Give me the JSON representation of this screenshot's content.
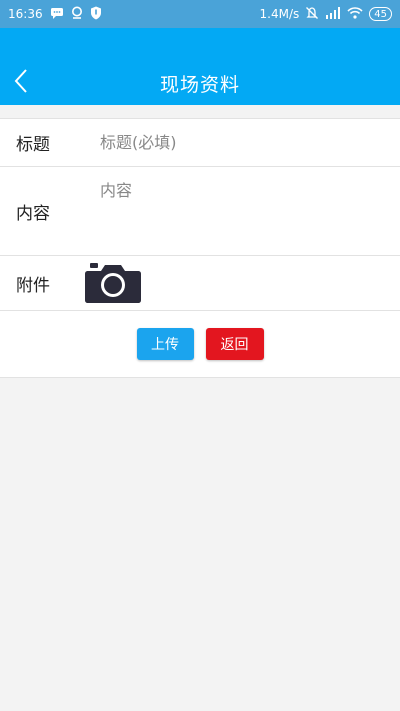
{
  "status_bar": {
    "time": "16:36",
    "network_speed": "1.4M/s",
    "battery": "45",
    "icons": [
      "message-icon",
      "location-icon",
      "shield-icon",
      "mute-icon",
      "signal-icon",
      "wifi-icon"
    ]
  },
  "header": {
    "title": "现场资料",
    "back_icon": "chevron-left-icon",
    "bg_color": "#03a9f4"
  },
  "form": {
    "title_label": "标题",
    "title_placeholder": "标题(必填)",
    "content_label": "内容",
    "content_placeholder": "内容",
    "attach_label": "附件",
    "attach_icon": "camera-icon"
  },
  "buttons": {
    "upload_label": "上传",
    "upload_color": "#1ba4ee",
    "back_label": "返回",
    "back_color": "#e3161f"
  }
}
